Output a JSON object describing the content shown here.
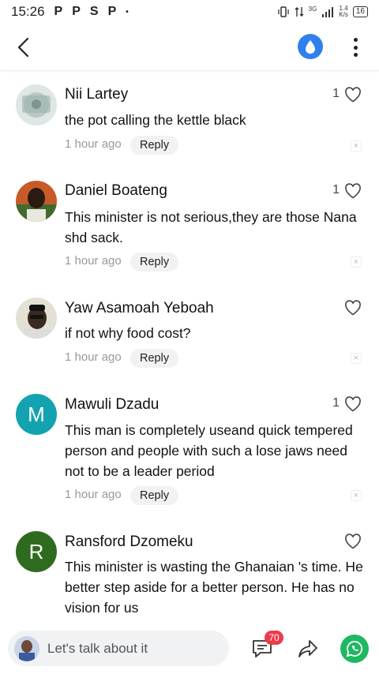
{
  "status_bar": {
    "time": "15:26",
    "apps": [
      "P",
      "P",
      "S",
      "P",
      "•"
    ],
    "network": "3G",
    "speed_value": "1.4",
    "speed_unit": "K/s",
    "battery": "16"
  },
  "header": {
    "back_icon": "chevron-left-icon",
    "drop_icon": "water-drop-icon",
    "more_icon": "more-vertical-icon",
    "accent_color": "#2f80ed"
  },
  "comments": [
    {
      "name": "Nii Lartey",
      "likes": "1",
      "text": "the pot calling the kettle black",
      "time": "1 hour ago",
      "reply_label": "Reply",
      "avatar_type": "photo"
    },
    {
      "name": "Daniel Boateng",
      "likes": "1",
      "text": "This minister is not serious,they are those Nana shd sack.",
      "time": "1 hour ago",
      "reply_label": "Reply",
      "avatar_type": "photo"
    },
    {
      "name": "Yaw Asamoah Yeboah",
      "likes": "",
      "text": "if not why food cost?",
      "time": "1 hour ago",
      "reply_label": "Reply",
      "avatar_type": "photo"
    },
    {
      "name": "Mawuli Dzadu",
      "likes": "1",
      "text": "This man is completely useand quick tempered person and people with such a lose jaws need not to be a leader period",
      "time": "1 hour ago",
      "reply_label": "Reply",
      "avatar_type": "letter",
      "avatar_letter": "M",
      "avatar_color": "#13a3b0"
    },
    {
      "name": "Ransford Dzomeku",
      "likes": "",
      "text": "This minister is wasting the Ghanaian 's time. He better step aside for a  better person. He has no vision for us",
      "avatar_type": "letter",
      "avatar_letter": "R",
      "avatar_color": "#2e6b1f"
    }
  ],
  "bottom_bar": {
    "placeholder": "Let's talk about it",
    "comment_count": "70",
    "badge_color": "#f0394a",
    "whatsapp_color": "#1fb861"
  }
}
